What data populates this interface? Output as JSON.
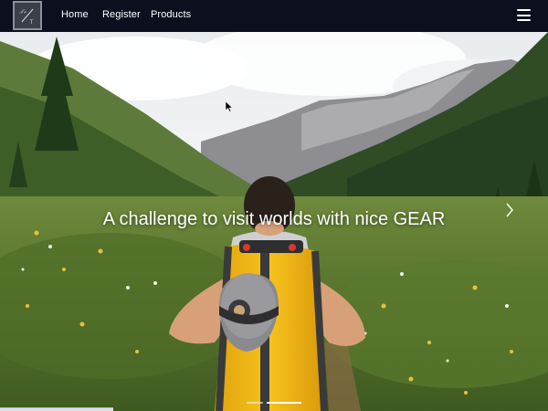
{
  "navbar": {
    "brand_alt": "Travel Gear logo",
    "links": [
      {
        "label": "Home"
      },
      {
        "label": "Register"
      },
      {
        "label": "Products"
      }
    ],
    "menu_icon": "hamburger-menu-icon"
  },
  "hero": {
    "caption": "A challenge to visit worlds with nice GEAR",
    "image_subject": "hiker with yellow backpack in mountain meadow",
    "next_icon": "chevron-right-icon",
    "slides_count": 2,
    "active_slide": 2
  },
  "colors": {
    "navbar_bg": "#0b0f1e",
    "text": "#ffffff",
    "backpack_accent": "#f2b512"
  }
}
